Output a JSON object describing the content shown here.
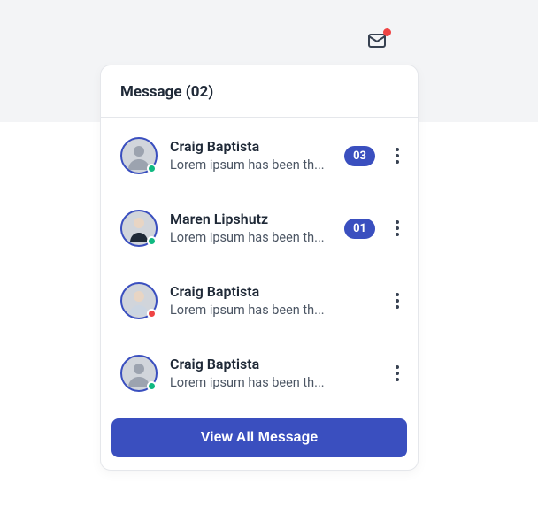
{
  "header": {
    "title": "Message (02)"
  },
  "messages": [
    {
      "name": "Craig Baptista",
      "preview": "Lorem ipsum has been th...",
      "badge": "03",
      "status": "online"
    },
    {
      "name": "Maren Lipshutz",
      "preview": "Lorem ipsum has been th...",
      "badge": "01",
      "status": "online"
    },
    {
      "name": "Craig Baptista",
      "preview": "Lorem ipsum has been th...",
      "badge": null,
      "status": "busy"
    },
    {
      "name": "Craig Baptista",
      "preview": "Lorem ipsum has been th...",
      "badge": null,
      "status": "online"
    }
  ],
  "footer": {
    "view_all": "View All Message"
  },
  "colors": {
    "accent": "#3a4fbf",
    "online": "#10b981",
    "busy": "#ef4444"
  }
}
